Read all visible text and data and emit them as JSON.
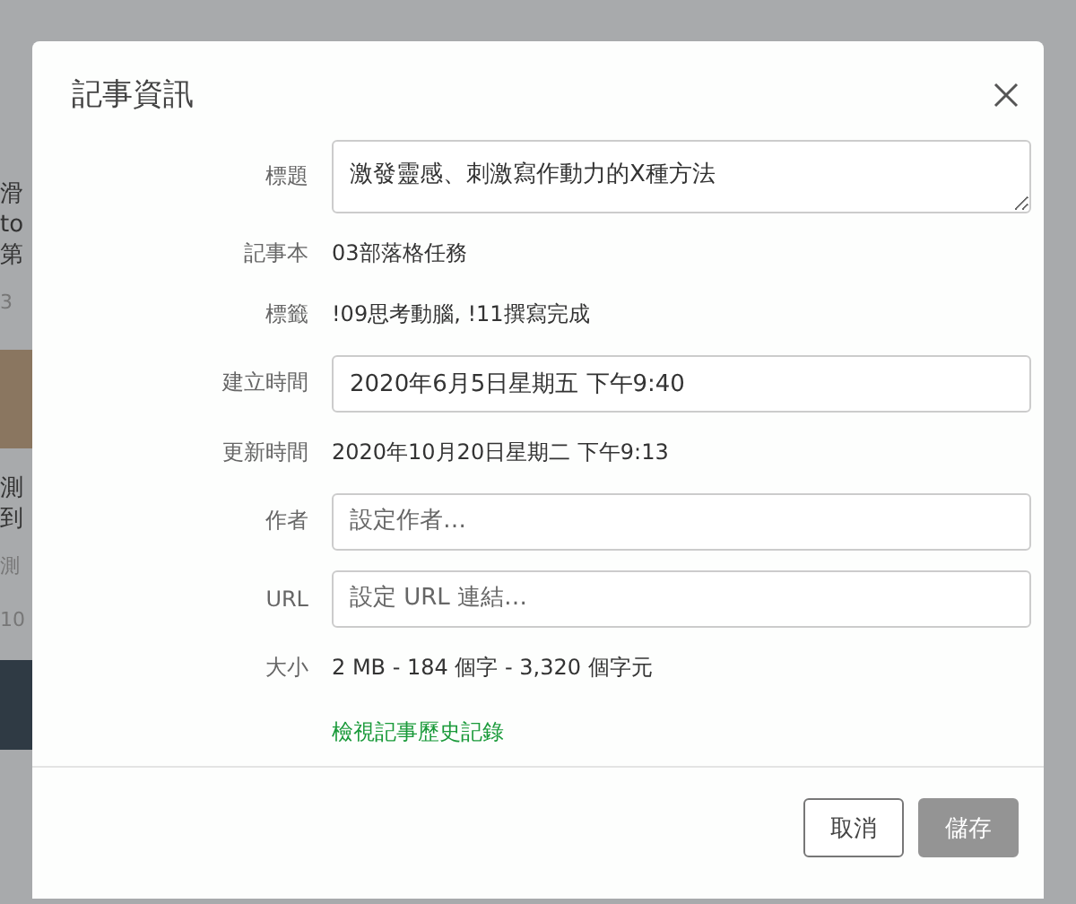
{
  "background": {
    "left_fragments": [
      {
        "text": "滑",
        "kind": "title"
      },
      {
        "text": "to",
        "kind": "title"
      },
      {
        "text": "第",
        "kind": "title"
      },
      {
        "text": "3",
        "kind": "meta"
      },
      {
        "kind": "photo"
      },
      {
        "text": "測",
        "kind": "title"
      },
      {
        "text": "到",
        "kind": "title"
      },
      {
        "text": "測",
        "kind": "meta"
      },
      {
        "text": "10",
        "kind": "meta"
      },
      {
        "kind": "thumbnail"
      }
    ]
  },
  "dialog": {
    "title": "記事資訊",
    "fields": [
      {
        "kind": "textarea",
        "label": "標題",
        "value": "激發靈感、刺激寫作動力的X種方法"
      },
      {
        "kind": "text",
        "label": "記事本",
        "value": "03部落格任務"
      },
      {
        "kind": "text",
        "label": "標籤",
        "value": "!09思考動腦, !11撰寫完成"
      },
      {
        "kind": "input",
        "label": "建立時間",
        "value": "2020年6月5日星期五 下午9:40"
      },
      {
        "kind": "text",
        "label": "更新時間",
        "value": "2020年10月20日星期二 下午9:13"
      },
      {
        "kind": "input",
        "label": "作者",
        "placeholder": "設定作者…"
      },
      {
        "kind": "input",
        "label": "URL",
        "placeholder": "設定 URL 連結…"
      },
      {
        "kind": "text",
        "label": "大小",
        "value": "2 MB - 184 個字 - 3,320 個字元"
      },
      {
        "kind": "link",
        "value": "檢視記事歷史記錄"
      }
    ],
    "buttons": [
      {
        "label": "取消",
        "disabled": false
      },
      {
        "label": "儲存",
        "disabled": true
      }
    ]
  }
}
